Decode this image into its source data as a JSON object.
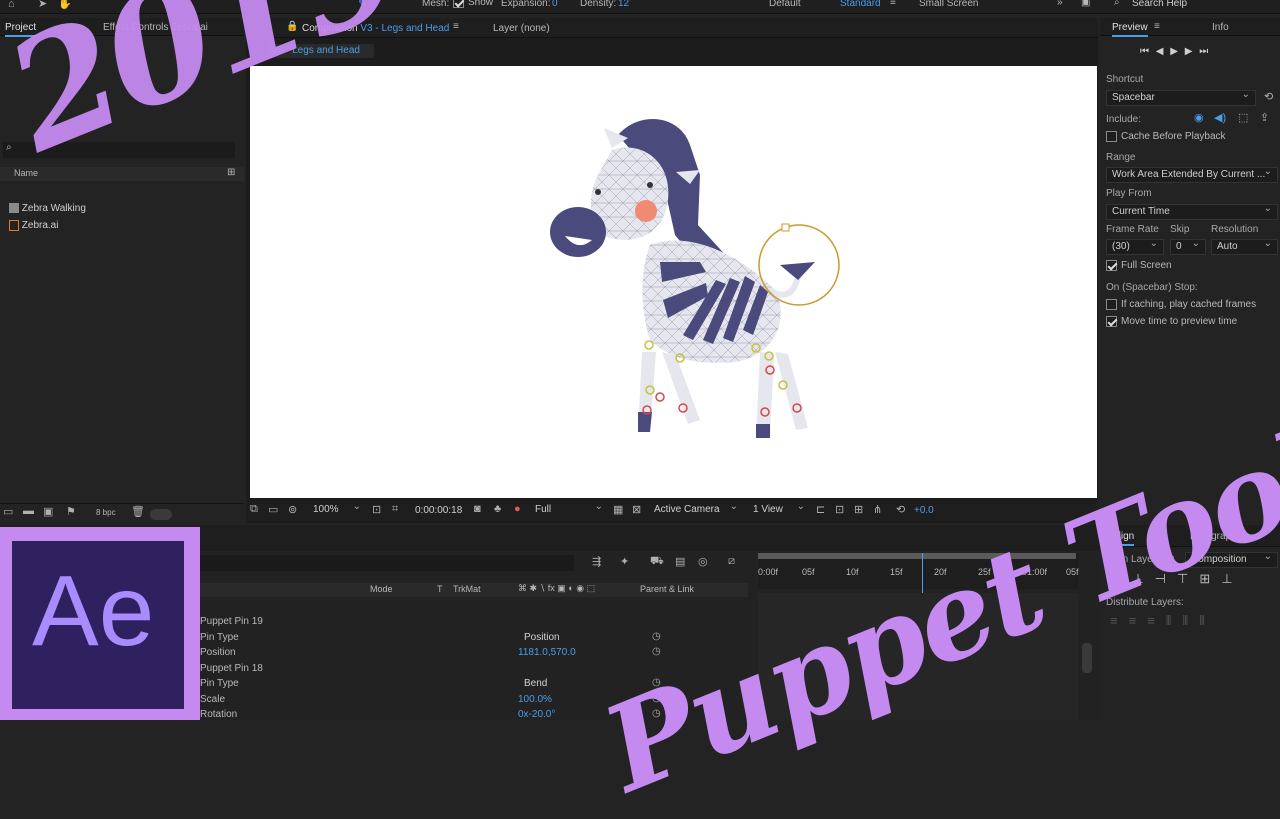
{
  "toolbar": {
    "mesh_label": "Mesh:",
    "show_label": "Show",
    "expansion_label": "Expansion:",
    "expansion_value": "0",
    "density_label": "Density:",
    "density_value": "12",
    "workspaces": [
      "Default",
      "Standard",
      "Small Screen"
    ],
    "search_placeholder": "Search Help"
  },
  "project": {
    "tab": "Project",
    "effect_controls_tab": "Effect Controls Zebra.ai",
    "column_name": "Name",
    "items": [
      "Zebra Walking",
      "Zebra.ai"
    ],
    "bpc": "8 bpc"
  },
  "composition": {
    "tab_prefix": "Composition",
    "tab_name": "V3 - Legs and Head",
    "layer_tab": "Layer (none)",
    "breadcrumb": "V3 - Legs and Head",
    "zoom": "100%",
    "timecode": "0:00:00:18",
    "resolution": "Full",
    "camera": "Active Camera",
    "views": "1 View",
    "exposure": "+0.0"
  },
  "preview": {
    "tab": "Preview",
    "info_tab": "Info",
    "shortcut_label": "Shortcut",
    "shortcut_value": "Spacebar",
    "include_label": "Include:",
    "cache_label": "Cache Before Playback",
    "range_label": "Range",
    "range_value": "Work Area Extended By Current ...",
    "play_from_label": "Play From",
    "play_from_value": "Current Time",
    "frame_rate_label": "Frame Rate",
    "skip_label": "Skip",
    "resolution_label": "Resolution",
    "frame_rate_value": "(30)",
    "skip_value": "0",
    "resolution_value": "Auto",
    "full_screen_label": "Full Screen",
    "on_stop_label": "On (Spacebar) Stop:",
    "if_caching_label": "If caching, play cached frames",
    "move_time_label": "Move time to preview time"
  },
  "align": {
    "tab": "Align",
    "align_to_label": "Align Layers to:",
    "align_to_value": "Composition",
    "distribute_label": "Distribute Layers:",
    "paragraph_tab": "Paragraph"
  },
  "timeline": {
    "mode_header": "Mode",
    "t_header": "T",
    "trkmat_header": "TrkMat",
    "parent_header": "Parent & Link",
    "ruler": [
      "0:00f",
      "05f",
      "10f",
      "15f",
      "20f",
      "25f",
      "01:00f",
      "05f"
    ],
    "rows": [
      {
        "name": "Puppet Pin 19",
        "value": ""
      },
      {
        "name": "Pin Type",
        "value": "Position"
      },
      {
        "name": "Position",
        "value": "1181.0,570.0"
      },
      {
        "name": "Puppet Pin 18",
        "value": ""
      },
      {
        "name": "Pin Type",
        "value": "Bend"
      },
      {
        "name": "Scale",
        "value": "100.0%"
      },
      {
        "name": "Rotation",
        "value": "0x-20.0°"
      }
    ]
  },
  "overlay": {
    "year": "2019",
    "logo": "Ae",
    "title": "Puppet Tool"
  },
  "colors": {
    "accent": "#4a9eea",
    "overlay_purple": "#c58af0",
    "logo_bg": "#2f2160",
    "logo_fg": "#a88cff"
  }
}
